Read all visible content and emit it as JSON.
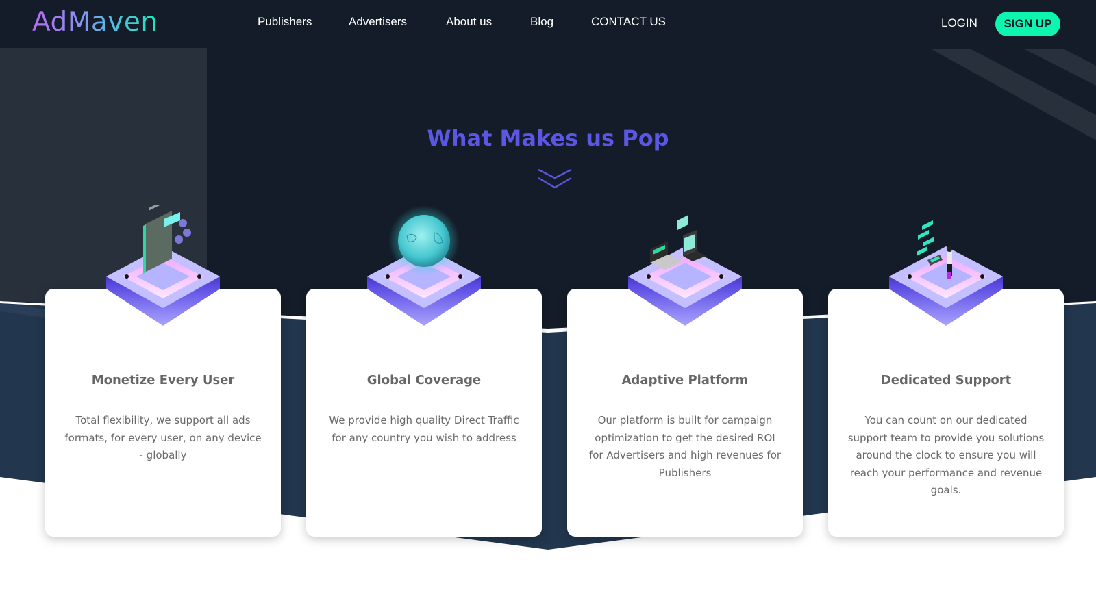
{
  "brand": {
    "logo_text": "AdMaven",
    "accent_color": "#5b56e3",
    "cta_color": "#0ef5b0",
    "background_dark": "#131c28",
    "band_color": "#22364d"
  },
  "nav": {
    "items": [
      {
        "label": "Publishers"
      },
      {
        "label": "Advertisers"
      },
      {
        "label": "About us"
      },
      {
        "label": "Blog"
      },
      {
        "label": "CONTACT US"
      }
    ],
    "login_label": "LOGIN",
    "signup_label": "SIGN UP"
  },
  "section": {
    "title": "What Makes us Pop",
    "scroll_icon": "double-chevron-down-icon"
  },
  "features": [
    {
      "icon": "mobile-ads-platform-icon",
      "title": "Monetize Every User",
      "description": "Total flexibility, we support all ads formats, for every user, on any device - globally"
    },
    {
      "icon": "globe-platform-icon",
      "title": "Global Coverage",
      "description": "We provide high quality Direct Traffic for any country you wish to address"
    },
    {
      "icon": "laptops-platform-icon",
      "title": "Adaptive Platform",
      "description": "Our platform is built for campaign optimization to get the desired ROI for Advertisers and high revenues for Publishers"
    },
    {
      "icon": "support-person-platform-icon",
      "title": "Dedicated Support",
      "description": "You can count on our dedicated support team to provide you solutions around the clock to ensure you will reach your performance and revenue goals."
    }
  ]
}
